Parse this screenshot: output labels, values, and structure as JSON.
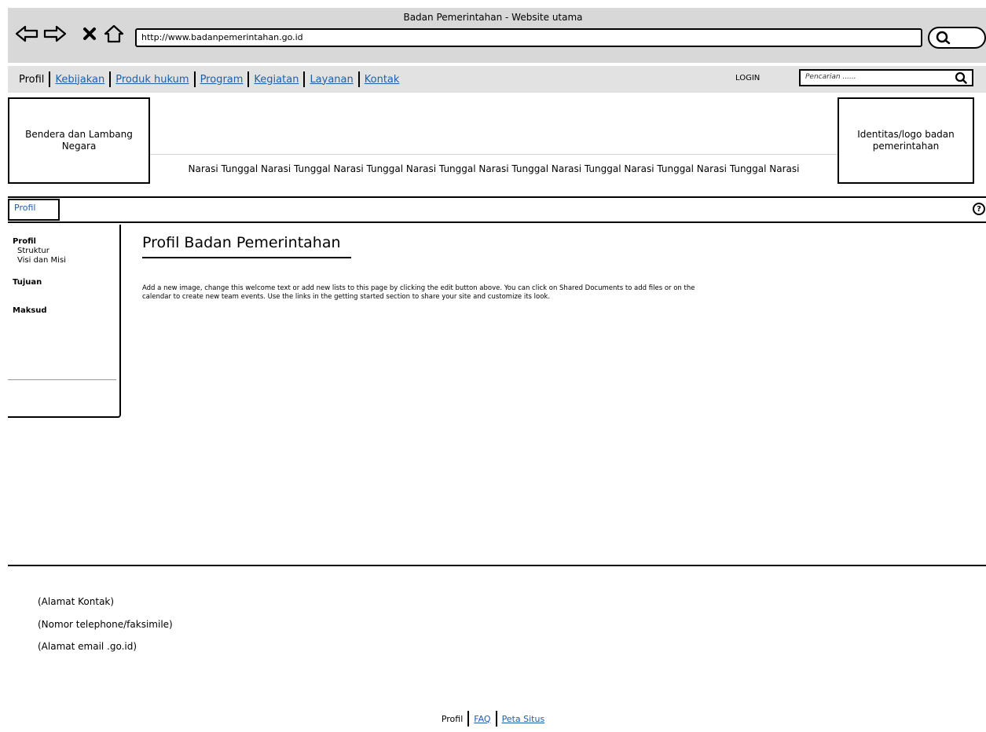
{
  "browser": {
    "title": "Badan Pemerintahan - Website utama",
    "url": "http://www.badanpemerintahan.go.id",
    "icons": [
      "back-arrow-icon",
      "forward-arrow-icon",
      "stop-icon",
      "home-icon",
      "search-icon"
    ]
  },
  "nav": {
    "items": [
      "Profil",
      "Kebijakan",
      "Produk hukum",
      "Program",
      "Kegiatan",
      "Layanan",
      "Kontak"
    ],
    "login": "LOGIN",
    "search_placeholder": "Pencarian ......"
  },
  "banner": {
    "left_box": "Bendera dan Lambang Negara",
    "right_box": "Identitas/logo badan pemerintahan",
    "marquee": "Narasi Tunggal Narasi Tunggal Narasi Tunggal Narasi Tunggal Narasi Tunggal Narasi Tunggal Narasi Tunggal Narasi Tunggal Narasi"
  },
  "tabs": {
    "active": "Profil"
  },
  "sidebar": {
    "profil": "Profil",
    "struktur": "Struktur",
    "visi": "Visi dan Misi",
    "tujuan": "Tujuan",
    "maksud": "Maksud"
  },
  "main": {
    "title": "Profil Badan Pemerintahan",
    "body": "Add a new image, change this welcome text or add new lists to this page by clicking the edit button above. You can click on Shared Documents to add files or on the calendar to create new team events. Use the links in the getting started section to share your site and customize its look."
  },
  "footer": {
    "address": "(Alamat Kontak)",
    "phone": "(Nomor telephone/faksimile)",
    "email": "(Alamat email .go.id)",
    "links": [
      "Profil",
      "FAQ",
      "Peta Situs"
    ]
  }
}
